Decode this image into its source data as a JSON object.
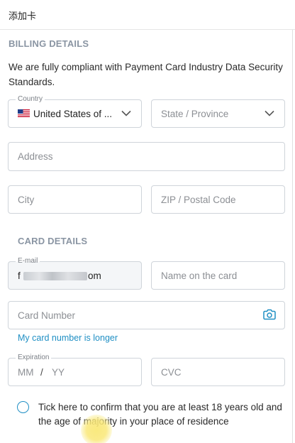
{
  "window": {
    "title": "添加卡"
  },
  "billing": {
    "section_title": "BILLING DETAILS",
    "description": "We are fully compliant with Payment Card Industry Data Security Standards.",
    "country": {
      "label": "Country",
      "value": "United States of ...",
      "flag_icon": "us-flag-icon"
    },
    "state": {
      "placeholder": "State / Province"
    },
    "address": {
      "placeholder": "Address"
    },
    "city": {
      "placeholder": "City"
    },
    "zip": {
      "placeholder": "ZIP / Postal Code"
    }
  },
  "card": {
    "section_title": "CARD DETAILS",
    "email": {
      "label": "E-mail",
      "value_start": "f",
      "value_end": "om"
    },
    "name": {
      "placeholder": "Name on the card"
    },
    "number": {
      "placeholder": "Card Number",
      "icon": "camera-icon"
    },
    "longer_link": "My card number is longer",
    "expiration": {
      "label": "Expiration",
      "mm": "MM",
      "sep": "/",
      "yy": "YY"
    },
    "cvc": {
      "placeholder": "CVC"
    }
  },
  "confirm": {
    "text": "Tick here to confirm that you are at least 18 years old and the age of majority in your place of residence"
  },
  "colors": {
    "accent": "#1f8fc4",
    "section_title": "#8a95a3",
    "border": "#cfd4da"
  }
}
